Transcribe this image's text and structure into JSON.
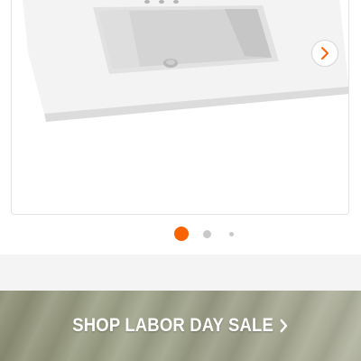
{
  "product_gallery": {
    "image_alt": "white vanity top with integrated rectangular sink and faucet holes",
    "next_icon": "chevron-right-icon",
    "dots": [
      {
        "active": true,
        "color": "#f96302"
      },
      {
        "active": false,
        "color": "#c9c9c9"
      },
      {
        "active": false,
        "color": "#c9c9c9"
      }
    ]
  },
  "promo_banner": {
    "label": "SHOP LABOR DAY SALE",
    "icon": "chevron-right-icon"
  },
  "colors": {
    "accent": "#f96302",
    "chevron": "#f96302",
    "banner_text": "#ffffff"
  }
}
